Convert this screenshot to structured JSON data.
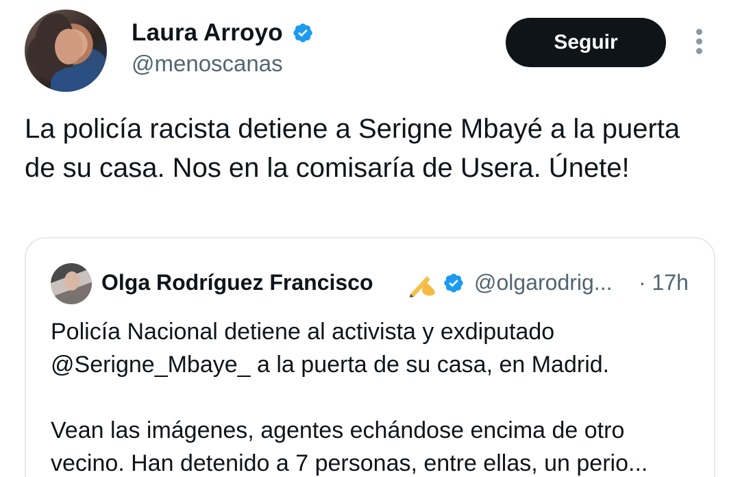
{
  "author": {
    "name": "Laura Arroyo",
    "handle": "@menoscanas",
    "verified": true,
    "avatar_icon": "profile-photo"
  },
  "follow_button_label": "Seguir",
  "more_icon": "more-vertical-icon",
  "tweet": {
    "text": "La policía racista detiene a Serigne Mbayé a la puerta de su casa. Nos  en la comisaría de Usera. Únete!"
  },
  "quote": {
    "name": "Olga Rodríguez Francisco",
    "emoji": "✍",
    "verified": true,
    "handle": "@olgarodrig...",
    "time": "· 17h",
    "text_line1": "Policía Nacional detiene al activista y exdiputado",
    "text_line2": "@Serigne_Mbaye_ a la puerta de su casa, en Madrid.",
    "text_line3": "Vean las imágenes, agentes echándose encima de otro",
    "text_line4": "vecino. Han detenido a 7 personas, entre ellas, un perio..."
  },
  "colors": {
    "verified_blue": "#1d9bf0",
    "text_primary": "#0f1419",
    "text_secondary": "#536471",
    "button_bg": "#0f1419",
    "border": "#e6e9ec"
  }
}
